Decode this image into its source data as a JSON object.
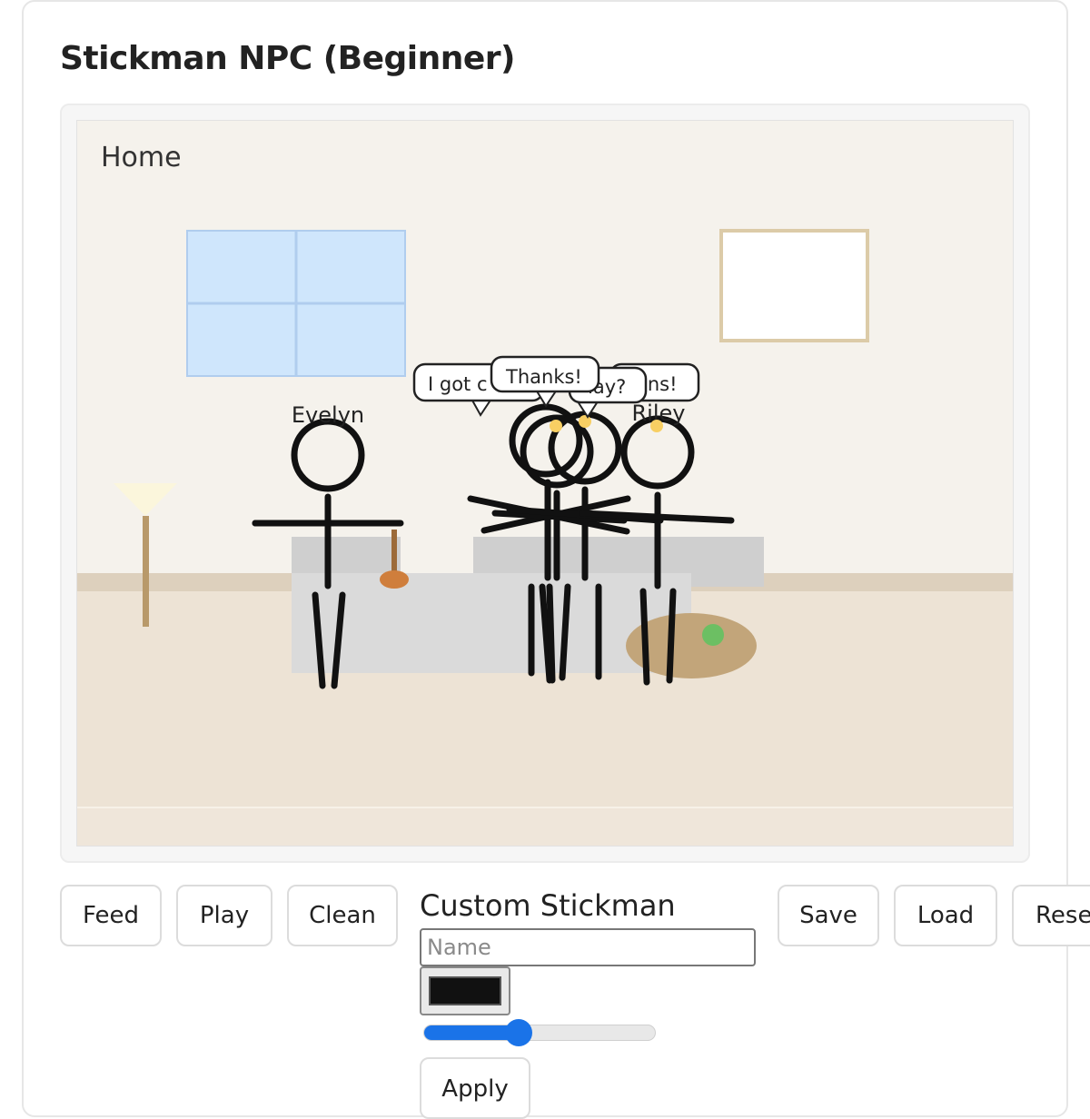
{
  "app": {
    "title": "Stickman NPC (Beginner)"
  },
  "scene": {
    "room_label": "Home",
    "colors": {
      "wall": "#f5f2ec",
      "floor": "#ede3d5",
      "baseboard": "#ddd0bd",
      "window": "#cfe6fc",
      "window_frame": "#b0cdee",
      "picture_frame": "#dccba8",
      "table": "#cfcfcf",
      "rug": "#c2a57a",
      "ball": "#6cbf63",
      "lamp_pole": "#b8996a",
      "lamp_shade": "#fbf6dc",
      "plunger": "#cf7e3c",
      "stick": "#111111",
      "mood_dot": "#f8cf63"
    },
    "npcs": [
      {
        "name": "Evelyn"
      },
      {
        "name": "Riley"
      }
    ],
    "bubbles": [
      {
        "text": "I got c"
      },
      {
        "text": "lay?"
      },
      {
        "text": "ins!"
      },
      {
        "text": "Thanks!"
      }
    ]
  },
  "controls": {
    "feed": "Feed",
    "play": "Play",
    "clean": "Clean",
    "save": "Save",
    "load": "Load",
    "reset": "Rese"
  },
  "custom": {
    "title": "Custom Stickman",
    "name_placeholder": "Name",
    "color_value": "#111111",
    "size_level_fraction": 0.41,
    "apply": "Apply"
  }
}
